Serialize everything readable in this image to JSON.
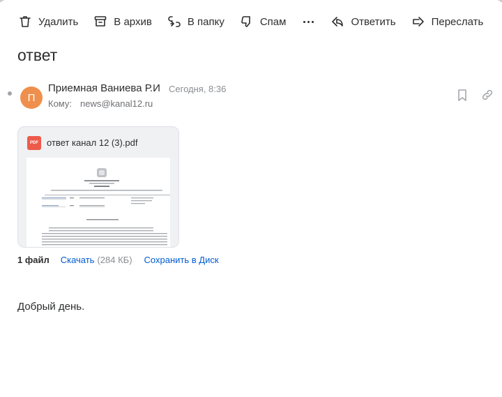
{
  "toolbar": {
    "delete_label": "Удалить",
    "archive_label": "В архив",
    "folder_label": "В папку",
    "spam_label": "Спам",
    "reply_label": "Ответить",
    "forward_label": "Переслать"
  },
  "message": {
    "subject": "ответ",
    "avatar_letter": "П",
    "avatar_color": "#ef8f4d",
    "sender": "Приемная Ваниева Р.И",
    "date": "Сегодня, 8:36",
    "to_label": "Кому:",
    "to_value": "news@kanal12.ru",
    "body": "Добрый день."
  },
  "attachment": {
    "badge": "PDF",
    "filename": "ответ канал 12 (3).pdf",
    "files_count": "1 файл",
    "download_label": "Скачать",
    "size": "(284 КБ)",
    "save_label": "Сохранить в Диск"
  },
  "colors": {
    "link": "#005bd1",
    "pdf_badge": "#ee5a4a"
  }
}
